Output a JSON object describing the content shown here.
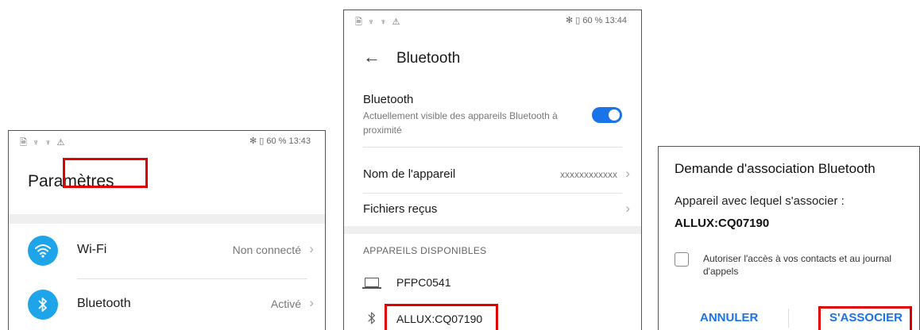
{
  "colors": {
    "accent": "#1a73e8",
    "icon_bg": "#1ea4e9",
    "highlight": "#e10000"
  },
  "screen1": {
    "status_left": "🗎 ♆ ♆ ⚠",
    "status_right": "✻ ▯ 60 %  13:43",
    "title": "Paramètres",
    "items": [
      {
        "label": "Wi-Fi",
        "value": "Non connecté",
        "icon": "wifi-icon"
      },
      {
        "label": "Bluetooth",
        "value": "Activé",
        "icon": "bluetooth-icon"
      }
    ]
  },
  "screen2": {
    "status_left": "🗎 ♆ ♆ ⚠",
    "status_right": "✻ ▯ 60 %  13:44",
    "title": "Bluetooth",
    "bluetooth_label": "Bluetooth",
    "bluetooth_sub": "Actuellement visible des appareils Bluetooth à proximité",
    "toggle_on": true,
    "device_name_label": "Nom de l'appareil",
    "device_name_value": "xxxxxxxxxxxx",
    "received_files": "Fichiers reçus",
    "section": "APPAREILS DISPONIBLES",
    "devices": [
      {
        "name": "PFPC0541",
        "icon": "laptop-icon"
      },
      {
        "name": "ALLUX:CQ07190",
        "icon": "bluetooth-icon"
      }
    ]
  },
  "screen3": {
    "title": "Demande d'association Bluetooth",
    "line": "Appareil avec lequel s'associer :",
    "device": "ALLUX:CQ07190",
    "checkbox_label": "Autoriser l'accès à vos contacts et au journal d'appels",
    "cancel": "ANNULER",
    "pair": "S'ASSOCIER"
  }
}
